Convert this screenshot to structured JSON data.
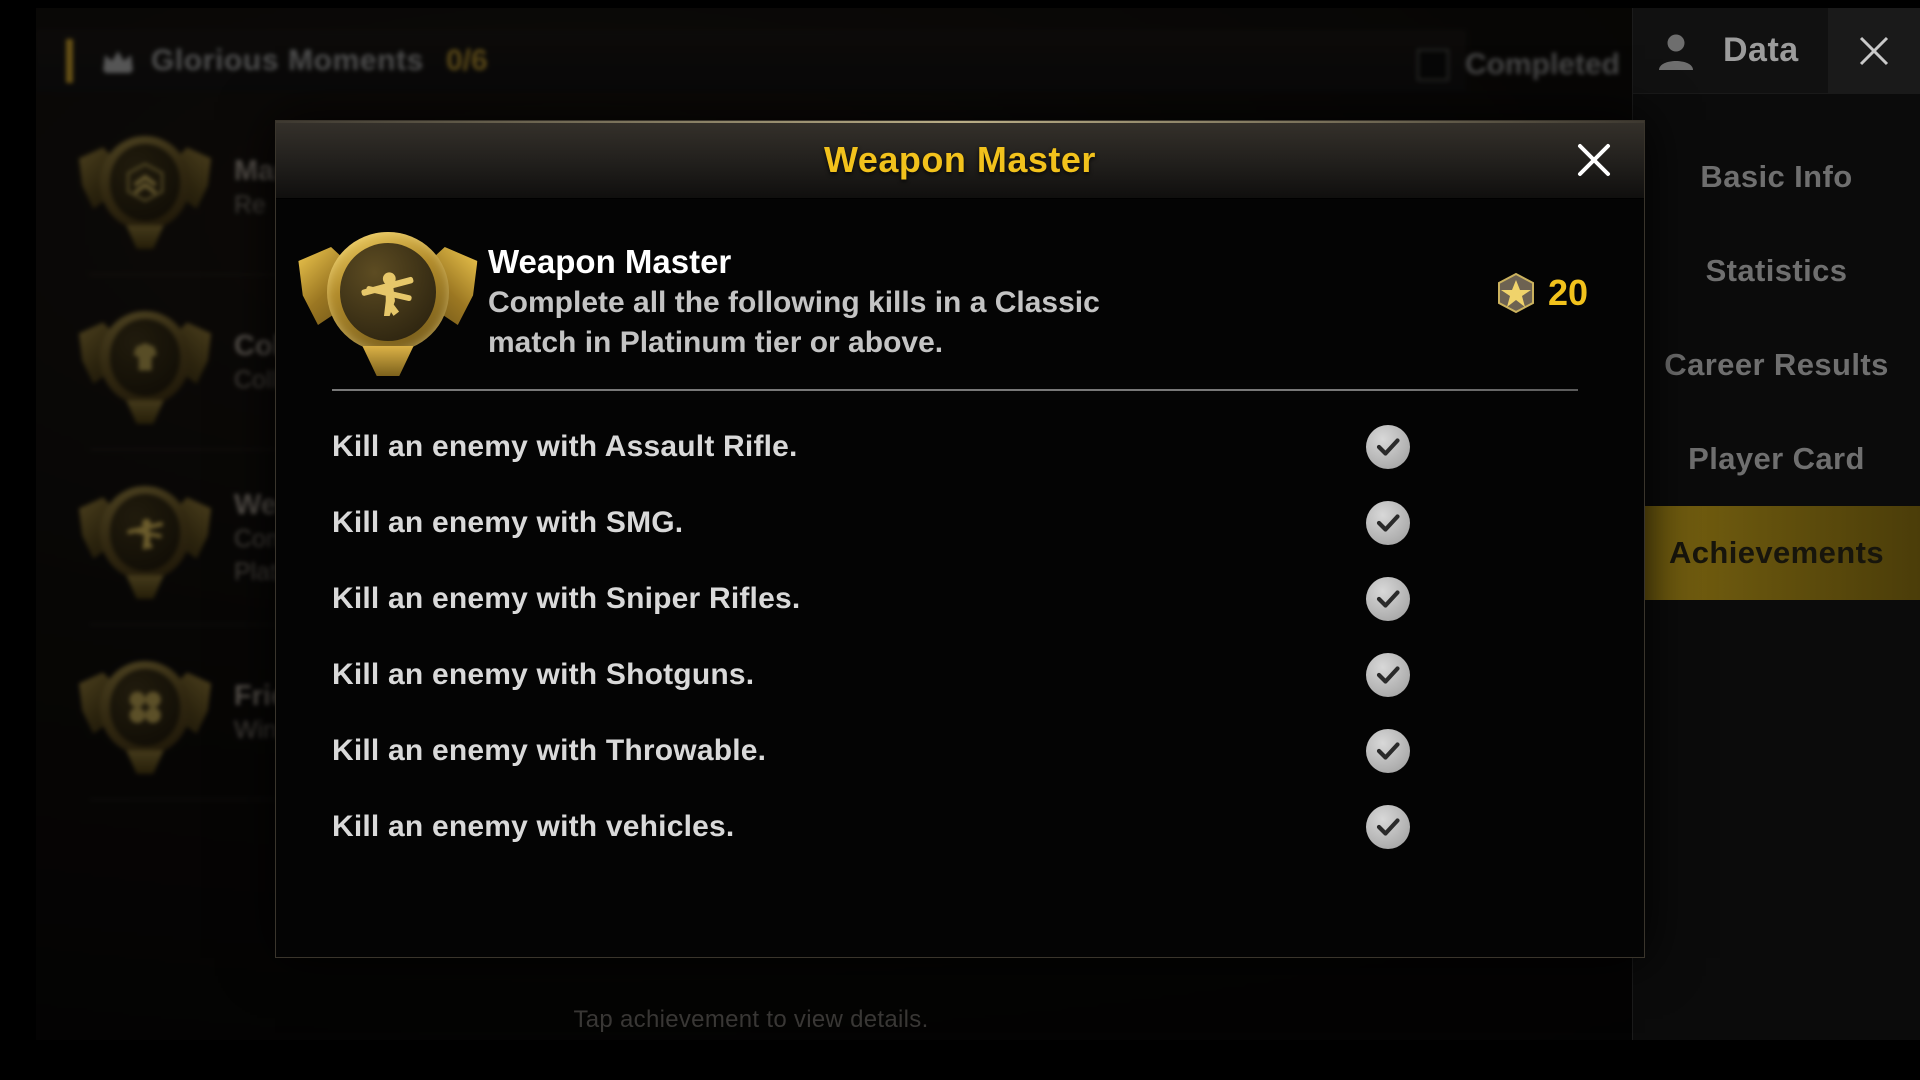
{
  "background": {
    "header": {
      "icon": "crown-icon",
      "title": "Glorious Moments",
      "count": "0/6",
      "completed_label": "Completed",
      "menu_icon": "list-menu-icon"
    },
    "rows": [
      {
        "title": "Marksman",
        "desc": "Re",
        "icon": "rank-chevron-medal"
      },
      {
        "title": "Collector",
        "desc": "Collect ... in a match",
        "icon": "armor-medal"
      },
      {
        "title": "Weapon Master",
        "desc": "Complete all the following kills in a Classic match in Platinum tier or above.",
        "icon": "weapon-master-medal"
      },
      {
        "title": "Friendship",
        "desc": "Win a match in a team with friends.",
        "icon": "clover-medal"
      }
    ],
    "hint": "Tap achievement to view details."
  },
  "sidebar": {
    "avatar_icon": "user-avatar-icon",
    "title": "Data",
    "close_icon": "close-icon",
    "items": [
      {
        "label": "Basic Info",
        "active": false
      },
      {
        "label": "Statistics",
        "active": false
      },
      {
        "label": "Career Results",
        "active": false
      },
      {
        "label": "Player Card",
        "active": false
      },
      {
        "label": "Achievements",
        "active": true
      }
    ]
  },
  "modal": {
    "title": "Weapon Master",
    "close_icon": "close-icon",
    "achievement": {
      "medal_icon": "weapon-master-medal",
      "name": "Weapon Master",
      "description_line1": "Complete all the following kills in a Classic",
      "description_line2": " match in Platinum tier or above.",
      "reward_icon": "achievement-point-icon",
      "reward_value": "20"
    },
    "tasks": [
      {
        "label": "Kill an enemy with Assault Rifle.",
        "status": "completed",
        "status_icon": "check-circle-icon"
      },
      {
        "label": "Kill an enemy with SMG.",
        "status": "completed",
        "status_icon": "check-circle-icon"
      },
      {
        "label": "Kill an enemy with Sniper Rifles.",
        "status": "completed",
        "status_icon": "check-circle-icon"
      },
      {
        "label": "Kill an enemy with Shotguns.",
        "status": "completed",
        "status_icon": "check-circle-icon"
      },
      {
        "label": "Kill an enemy with Throwable.",
        "status": "completed",
        "status_icon": "check-circle-icon"
      },
      {
        "label": "Kill an enemy with vehicles.",
        "status": "completed",
        "status_icon": "check-circle-icon"
      }
    ]
  },
  "colors": {
    "accent_gold": "#f2c21c",
    "sidebar_active": "#7a6410",
    "header_accent": "#b89126",
    "check_fill": "#c4c4c4"
  }
}
